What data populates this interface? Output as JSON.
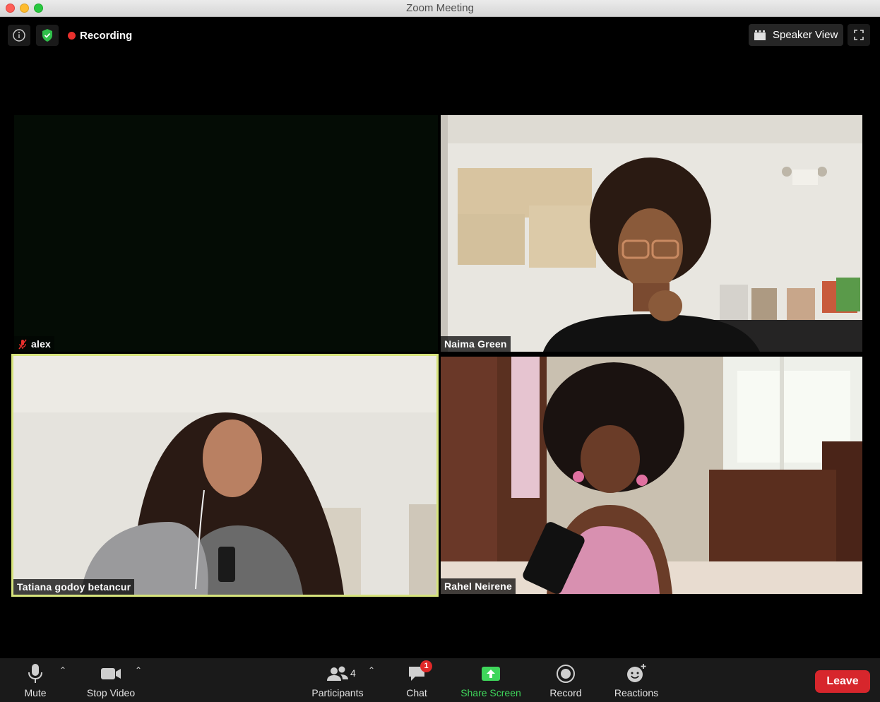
{
  "window": {
    "title": "Zoom Meeting"
  },
  "status": {
    "recording_label": "Recording"
  },
  "view": {
    "speaker_view_label": "Speaker View"
  },
  "participants": [
    {
      "name": "alex",
      "muted": true,
      "video": false
    },
    {
      "name": "Naima Green",
      "muted": false,
      "video": true
    },
    {
      "name": "Tatiana godoy betancur",
      "muted": false,
      "video": true,
      "active_speaker": true
    },
    {
      "name": "Rahel Neirene",
      "muted": false,
      "video": true
    }
  ],
  "toolbar": {
    "mute_label": "Mute",
    "stop_video_label": "Stop Video",
    "participants_label": "Participants",
    "participants_count": "4",
    "chat_label": "Chat",
    "chat_badge": "1",
    "share_label": "Share Screen",
    "record_label": "Record",
    "reactions_label": "Reactions",
    "leave_label": "Leave"
  },
  "colors": {
    "recording_dot": "#e8302d",
    "share_green": "#3fd65b",
    "leave_red": "#d7262c",
    "active_speaker_border": "#d6e37c",
    "security_shield": "#2fbf4a"
  }
}
